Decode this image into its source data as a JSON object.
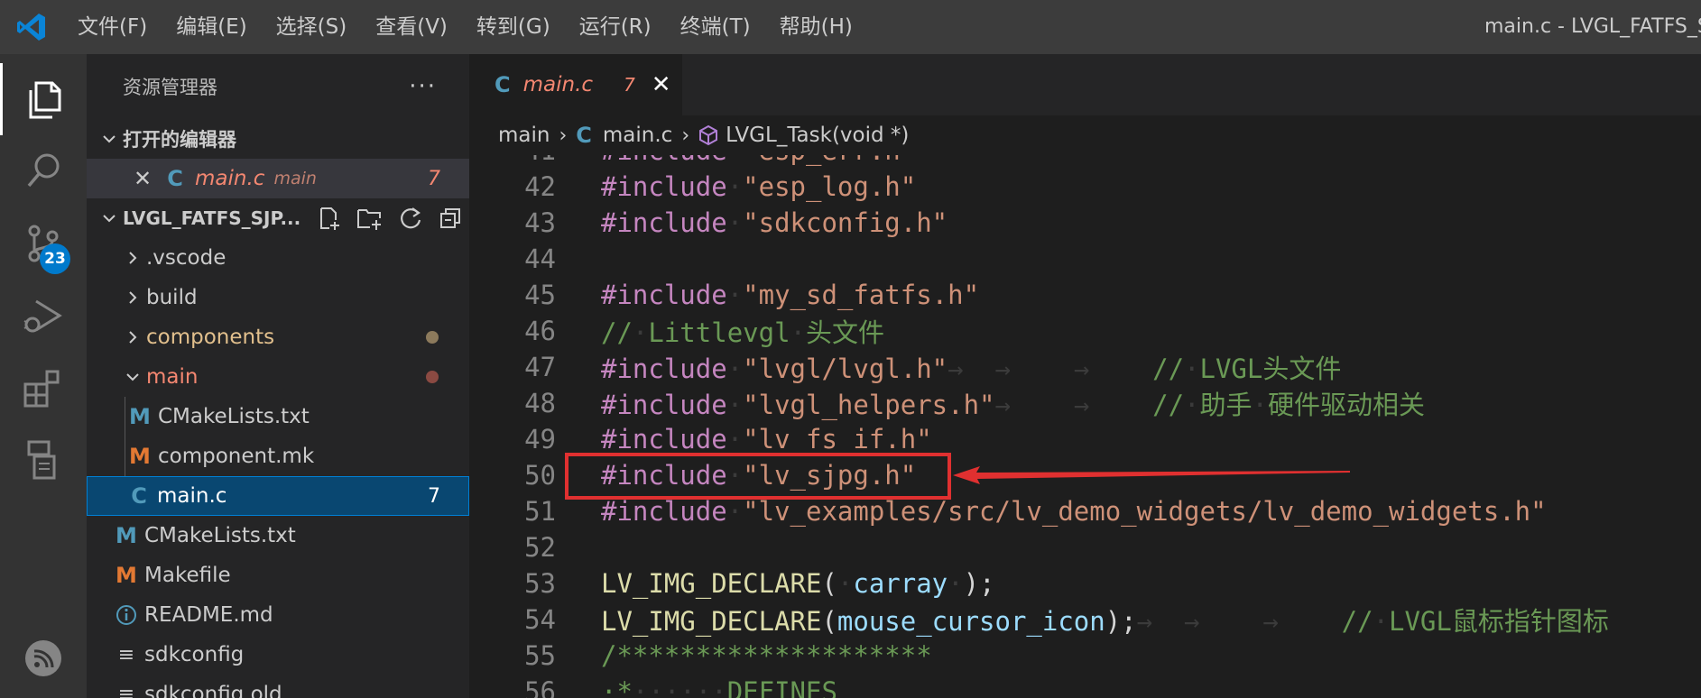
{
  "window": {
    "title": "main.c - LVGL_FATFS_SJ"
  },
  "menu": [
    "文件(F)",
    "编辑(E)",
    "选择(S)",
    "查看(V)",
    "转到(G)",
    "运行(R)",
    "终端(T)",
    "帮助(H)"
  ],
  "activity": {
    "scm_badge": "23"
  },
  "explorer": {
    "title": "资源管理器",
    "more": "···",
    "open_editors_label": "打开的编辑器",
    "open_editor": {
      "name": "main.c",
      "folder": "main",
      "count": "7"
    },
    "project_label": "LVGL_FATFS_SJP...",
    "tree": [
      {
        "label": ".vscode",
        "type": "folder",
        "expanded": false,
        "color": "#cccccc"
      },
      {
        "label": "build",
        "type": "folder",
        "expanded": false,
        "color": "#cccccc"
      },
      {
        "label": "components",
        "type": "folder",
        "expanded": false,
        "color": "#e2c08d",
        "dot": "#8c7a5c"
      },
      {
        "label": "main",
        "type": "folder",
        "expanded": true,
        "color": "#f48771",
        "dot": "#8b4a42"
      },
      {
        "label": "CMakeLists.txt",
        "type": "file",
        "icon": "M",
        "color": "#cccccc"
      },
      {
        "label": "component.mk",
        "type": "file",
        "icon": "M",
        "color": "#cccccc"
      },
      {
        "label": "main.c",
        "type": "file",
        "icon": "C",
        "color": "#f48771",
        "count": "7"
      },
      {
        "label": "CMakeLists.txt",
        "type": "file",
        "icon": "M",
        "color": "#cccccc"
      },
      {
        "label": "Makefile",
        "type": "file",
        "icon": "M",
        "color": "#cccccc"
      },
      {
        "label": "README.md",
        "type": "file",
        "icon": "i",
        "color": "#cccccc"
      },
      {
        "label": "sdkconfig",
        "type": "file",
        "icon": "≡",
        "color": "#cccccc"
      },
      {
        "label": "sdkconfig.old",
        "type": "file",
        "icon": "≡",
        "color": "#cccccc"
      }
    ]
  },
  "editor": {
    "tab": {
      "icon": "C",
      "name": "main.c",
      "count": "7"
    },
    "breadcrumb": [
      "main",
      "main.c",
      "LVGL_Task(void *)"
    ],
    "lines": [
      {
        "n": "41",
        "tokens": [
          [
            "kw",
            "#include"
          ],
          [
            "ws",
            "·"
          ],
          [
            "str",
            "\"esp_err.h\""
          ]
        ]
      },
      {
        "n": "42",
        "tokens": [
          [
            "kw",
            "#include"
          ],
          [
            "ws",
            "·"
          ],
          [
            "str",
            "\"esp_log.h\""
          ]
        ]
      },
      {
        "n": "43",
        "tokens": [
          [
            "kw",
            "#include"
          ],
          [
            "ws",
            "·"
          ],
          [
            "str",
            "\"sdkconfig.h\""
          ]
        ]
      },
      {
        "n": "44",
        "tokens": []
      },
      {
        "n": "45",
        "tokens": [
          [
            "kw",
            "#include"
          ],
          [
            "ws",
            "·"
          ],
          [
            "str",
            "\"my_sd_fatfs.h\""
          ]
        ]
      },
      {
        "n": "46",
        "tokens": [
          [
            "cmt",
            "//"
          ],
          [
            "ws",
            "·"
          ],
          [
            "cmt",
            "Littlevgl"
          ],
          [
            "ws",
            "·"
          ],
          [
            "cmt",
            "头文件"
          ]
        ]
      },
      {
        "n": "47",
        "tokens": [
          [
            "kw",
            "#include"
          ],
          [
            "ws",
            "·"
          ],
          [
            "str",
            "\"lvgl/lvgl.h\""
          ],
          [
            "ws",
            "→  →    →    "
          ],
          [
            "cmt",
            "//"
          ],
          [
            "ws",
            "·"
          ],
          [
            "cmt",
            "LVGL头文件"
          ]
        ]
      },
      {
        "n": "48",
        "tokens": [
          [
            "kw",
            "#include"
          ],
          [
            "ws",
            "·"
          ],
          [
            "str",
            "\"lvgl_helpers.h\""
          ],
          [
            "ws",
            "→    →    "
          ],
          [
            "cmt",
            "//"
          ],
          [
            "ws",
            "·"
          ],
          [
            "cmt",
            "助手"
          ],
          [
            "ws",
            "·"
          ],
          [
            "cmt",
            "硬件驱动相关"
          ]
        ]
      },
      {
        "n": "49",
        "tokens": [
          [
            "kw",
            "#include"
          ],
          [
            "ws",
            "·"
          ],
          [
            "str",
            "\"lv_fs_if.h\""
          ]
        ]
      },
      {
        "n": "50",
        "tokens": [
          [
            "kw",
            "#include"
          ],
          [
            "ws",
            "·"
          ],
          [
            "str",
            "\"lv_sjpg.h\""
          ]
        ]
      },
      {
        "n": "51",
        "tokens": [
          [
            "kw",
            "#include"
          ],
          [
            "ws",
            "·"
          ],
          [
            "str",
            "\"lv_examples/src/lv_demo_widgets/lv_demo_widgets.h\""
          ]
        ]
      },
      {
        "n": "52",
        "tokens": []
      },
      {
        "n": "53",
        "tokens": [
          [
            "fn",
            "LV_IMG_DECLARE"
          ],
          [
            "pl",
            "("
          ],
          [
            "ws",
            "·"
          ],
          [
            "var",
            "carray"
          ],
          [
            "ws",
            "·"
          ],
          [
            "pl",
            ");"
          ]
        ]
      },
      {
        "n": "54",
        "tokens": [
          [
            "fn",
            "LV_IMG_DECLARE"
          ],
          [
            "pl",
            "("
          ],
          [
            "var",
            "mouse_cursor_icon"
          ],
          [
            "pl",
            ");"
          ],
          [
            "ws",
            "→  →    →    "
          ],
          [
            "cmt",
            "//"
          ],
          [
            "ws",
            "·"
          ],
          [
            "cmt",
            "LVGL鼠标指针图标"
          ]
        ]
      },
      {
        "n": "55",
        "tokens": [
          [
            "cmt",
            "/********************"
          ]
        ]
      },
      {
        "n": "56",
        "tokens": [
          [
            "cmt",
            "·*"
          ],
          [
            "ws",
            "······"
          ],
          [
            "cmt",
            "DEFINES"
          ]
        ]
      }
    ]
  },
  "colors": {
    "accent": "#007acc",
    "highlight_box": "#e03030"
  }
}
